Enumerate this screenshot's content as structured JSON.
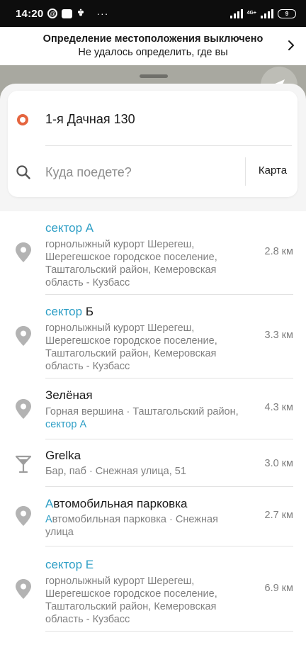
{
  "status_bar": {
    "time": "14:20",
    "icon_at": "@",
    "dots": "···",
    "network": "4G+",
    "battery": "9"
  },
  "location_banner": {
    "title": "Определение местоположения выключено",
    "subtitle": "Не удалось определить, где вы"
  },
  "route": {
    "from": "1-я Дачная 130",
    "search_placeholder": "Куда поедете?",
    "search_value": "",
    "map_button": "Карта"
  },
  "results": [
    {
      "title_hl": "сектор А",
      "title_rest": "",
      "desc_hl": "",
      "desc": "горнолыжный курорт Шерегеш, Шерегешское городское поселение, Таштагольский район, Кемеровская область - Кузбасс",
      "desc_tail_hl": "",
      "distance": "2.8 км",
      "icon": "pin-icon"
    },
    {
      "title_hl": "сектор",
      "title_rest": " Б",
      "desc_hl": "",
      "desc": "горнолыжный курорт Шерегеш, Шерегешское городское поселение, Таштагольский район, Кемеровская область - Кузбасс",
      "desc_tail_hl": "",
      "distance": "3.3 км",
      "icon": "pin-icon"
    },
    {
      "title_hl": "",
      "title_rest": "Зелёная",
      "desc_hl": "",
      "desc": "Горная вершина · Таштагольский район, ",
      "desc_tail_hl": "сектор А",
      "distance": "4.3 км",
      "icon": "pin-icon"
    },
    {
      "title_hl": "",
      "title_rest": "Grelka",
      "desc_hl": "",
      "desc": "Бар, паб · Снежная улица, 51",
      "desc_tail_hl": "",
      "distance": "3.0 км",
      "icon": "cocktail-icon"
    },
    {
      "title_hl": "А",
      "title_rest": "втомобильная парковка",
      "desc_hl": "А",
      "desc": "втомобильная парковка · Снежная улица",
      "desc_tail_hl": "",
      "distance": "2.7 км",
      "icon": "pin-icon"
    },
    {
      "title_hl": "сектор Е",
      "title_rest": "",
      "desc_hl": "",
      "desc": "горнолыжный курорт Шерегеш, Шерегешское городское поселение, Таштагольский район, Кемеровская область - Кузбасс",
      "desc_tail_hl": "",
      "distance": "6.9 км",
      "icon": "pin-icon"
    }
  ],
  "colors": {
    "highlight": "#2f9fc6",
    "origin_dot": "#e5653f",
    "secondary_text": "#7f7f7f"
  }
}
